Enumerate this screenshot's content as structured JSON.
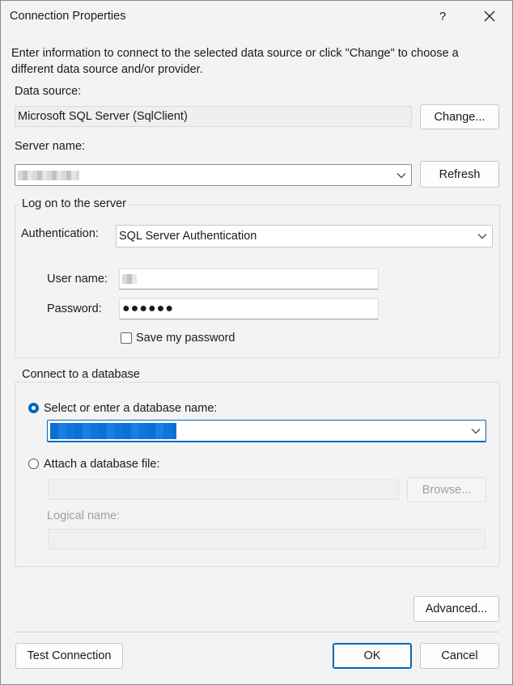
{
  "window": {
    "title": "Connection Properties",
    "help_label": "?"
  },
  "intro_text": "Enter information to connect to the selected data source or click \"Change\" to choose a different data source and/or provider.",
  "data_source": {
    "label": "Data source:",
    "value": "Microsoft SQL Server (SqlClient)",
    "change_button": "Change..."
  },
  "server": {
    "label": "Server name:",
    "value": "",
    "refresh_button": "Refresh"
  },
  "logon": {
    "group_title": "Log on to the server",
    "auth_label": "Authentication:",
    "auth_value": "SQL Server Authentication",
    "user_label": "User name:",
    "user_value": "",
    "password_label": "Password:",
    "password_value": "●●●●●●",
    "save_password_label": "Save my password",
    "save_password_checked": false
  },
  "database": {
    "group_title": "Connect to a database",
    "select_label": "Select or enter a database name:",
    "select_checked": true,
    "db_name_value": "",
    "attach_label": "Attach a database file:",
    "attach_checked": false,
    "browse_button": "Browse...",
    "logical_label": "Logical name:"
  },
  "footer": {
    "advanced_button": "Advanced...",
    "test_button": "Test Connection",
    "ok_button": "OK",
    "cancel_button": "Cancel"
  },
  "colors": {
    "accent": "#0067c0",
    "selection": "#0a6fd6"
  }
}
